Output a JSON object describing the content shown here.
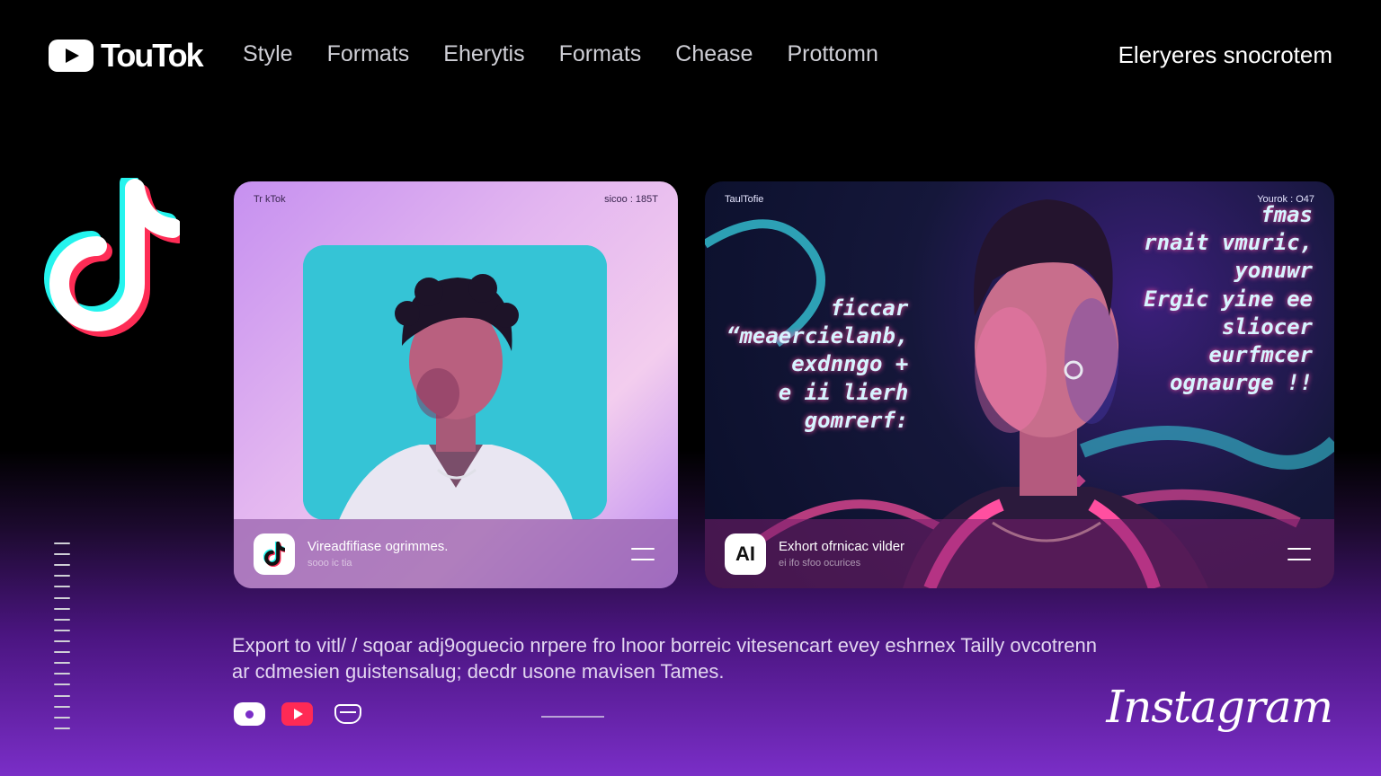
{
  "header": {
    "brand": "TouTok",
    "nav": [
      "Style",
      "Formats",
      "Eherytis",
      "Formats",
      "Chease",
      "Prottomn"
    ],
    "right_link": "Eleryeres snocrotem"
  },
  "cards": [
    {
      "top_left": "Tr kTok",
      "top_right": "sicoo : 185T",
      "footer_title": "Vireadfifiase ogrimmes.",
      "footer_sub": "sooo ic tia"
    },
    {
      "top_left": "TaulTofie",
      "top_right": "Yourok : O47",
      "badge": "AI",
      "footer_title": "Exhort ofrnicac vilder",
      "footer_sub": "ei ifo sfoo ocurices",
      "overlay_left": [
        "ficcar",
        "“meaercielanb,",
        "exdnngo +",
        "e ii lierh",
        "gomrerf:"
      ],
      "overlay_right": [
        "fmas",
        "rnait vmuric,",
        "yonuwr",
        "Ergic yine ee",
        "sliocer",
        "eurfmcer",
        "ognaurge !!"
      ]
    }
  ],
  "description": [
    "Export to vitl/ / sqoar adj9oguecio nrpere fro lnoor borreic vitesencart evey eshrnex Tailly ovcotrenn",
    "ar cdmesien guistensalug; decdr usone mavisen Tames."
  ],
  "footer_brand": "Instagram",
  "colors": {
    "accent_pink": "#ff2a55",
    "tiktok_cyan": "#25f4ee",
    "tiktok_red": "#fe2c55",
    "purple": "#7a2ec7"
  }
}
